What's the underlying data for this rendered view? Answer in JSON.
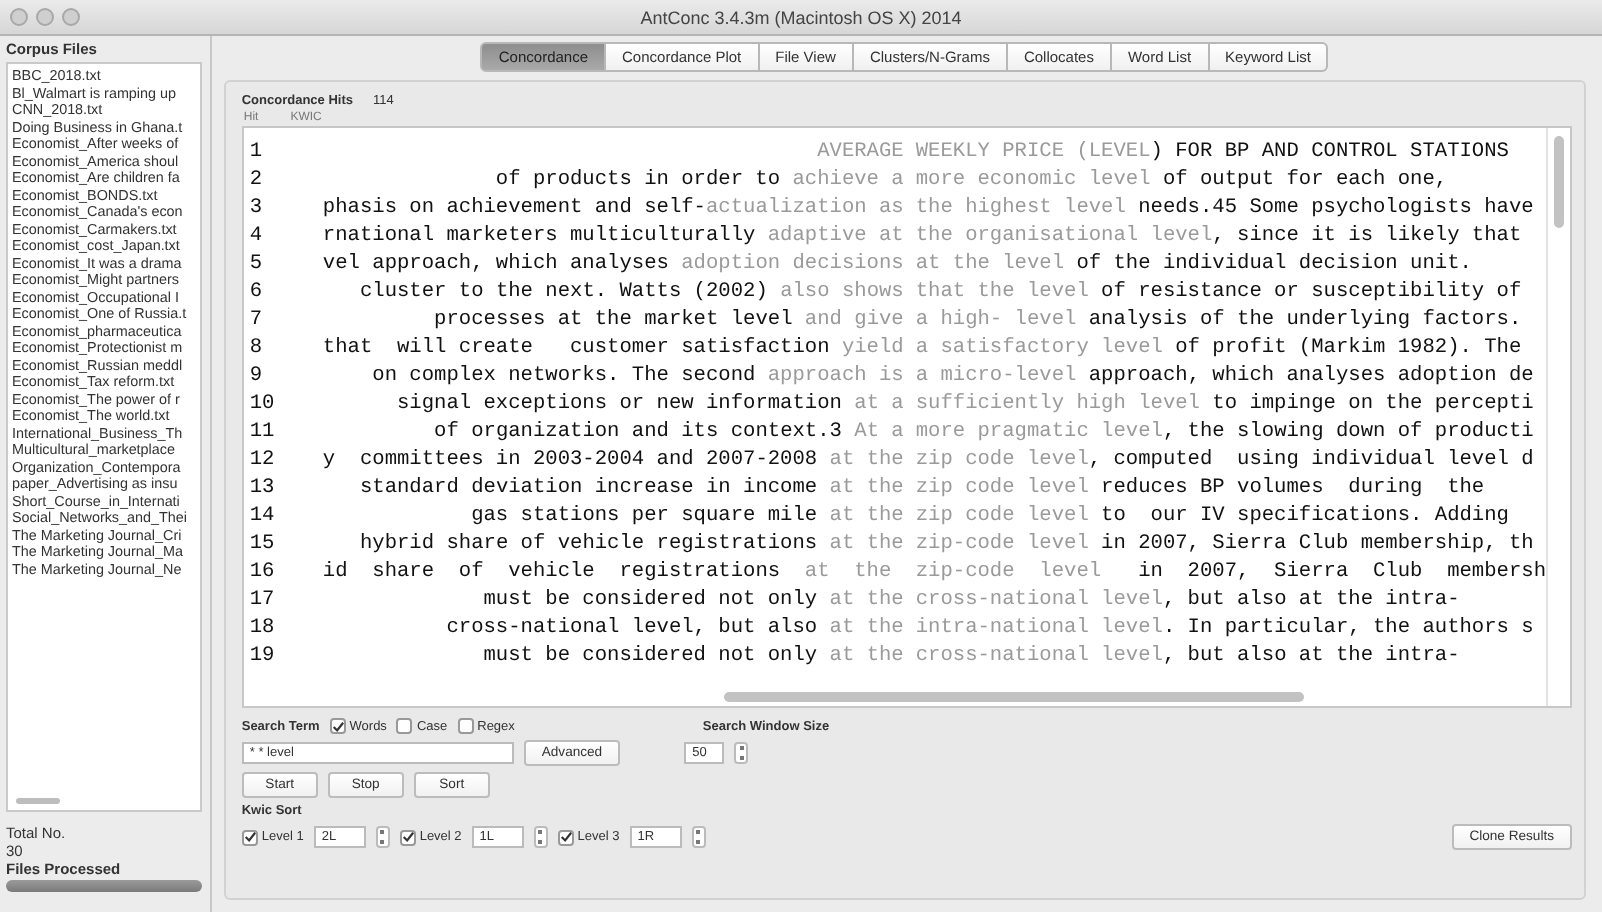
{
  "window": {
    "title": "AntConc 3.4.3m (Macintosh OS X) 2014"
  },
  "sidebar": {
    "title": "Corpus Files",
    "files": [
      "BBC_2018.txt",
      "Bl_Walmart is ramping up",
      "CNN_2018.txt",
      "Doing Business in Ghana.t",
      "Economist_After weeks of",
      "Economist_America shoul",
      "Economist_Are children fa",
      "Economist_BONDS.txt",
      "Economist_Canada's econ",
      "Economist_Carmakers.txt",
      "Economist_cost_Japan.txt",
      "Economist_It was a drama",
      "Economist_Might partners",
      "Economist_Occupational I",
      "Economist_One of Russia.t",
      "Economist_pharmaceutica",
      "Economist_Protectionist m",
      "Economist_Russian meddl",
      "Economist_Tax reform.txt",
      "Economist_The power of r",
      "Economist_The world.txt",
      "International_Business_Th",
      "Multicultural_marketplace",
      "Organization_Contempora",
      "paper_Advertising as insu",
      "Short_Course_in_Internati",
      "Social_Networks_and_Thei",
      "The Marketing Journal_Cri",
      "The Marketing Journal_Ma",
      "The Marketing Journal_Ne"
    ],
    "total_label": "Total No.",
    "total": "30",
    "processed_label": "Files Processed",
    "progress": {
      "level": 1
    }
  },
  "tabs": [
    {
      "label": "Concordance",
      "selected": true
    },
    {
      "label": "Concordance Plot",
      "selected": false
    },
    {
      "label": "File View",
      "selected": false
    },
    {
      "label": "Clusters/N-Grams",
      "selected": false
    },
    {
      "label": "Collocates",
      "selected": false
    },
    {
      "label": "Word List",
      "selected": false
    },
    {
      "label": "Keyword List",
      "selected": false
    }
  ],
  "hits": {
    "label": "Concordance Hits",
    "count": "114"
  },
  "columns": [
    "Hit",
    "KWIC"
  ],
  "rows": [
    {
      "n": "1",
      "left": "",
      "left_key": "AVERAGE",
      "right_key": "WEEKLY PRICE (LEVEL",
      "right": ") FOR BP AND CONTROL STATIONS"
    },
    {
      "n": "2",
      "left": "of products in order to",
      "left_key": "achieve a",
      "right_key": "more economic level",
      "right": "of output for each one,"
    },
    {
      "n": "3",
      "left": "phasis on achievement and self-",
      "left_key": "actualization as",
      "right_key": "the highest level",
      "right": "needs.45 Some psychologists have"
    },
    {
      "n": "4",
      "left": "rnational marketers multiculturally",
      "left_key": "adaptive at",
      "right_key": "the organisational level",
      "right": ", since it is likely that"
    },
    {
      "n": "5",
      "left": "vel approach, which analyses",
      "left_key": "adoption decisions",
      "right_key": "at the level",
      "right": "of the individual decision unit."
    },
    {
      "n": "6",
      "left": "cluster to the next. Watts (2002)",
      "left_key": "also shows",
      "right_key": "that the level",
      "right": "of resistance or susceptibility of"
    },
    {
      "n": "7",
      "left": "processes at the market level",
      "left_key": "and give",
      "right_key": "a high- level",
      "right": "analysis of the underlying factors."
    },
    {
      "n": "8",
      "left": "that  will create   customer satisfaction",
      "left_key": "yield",
      "right_key": "a satisfactory level",
      "right": "of profit (Markim 1982). The"
    },
    {
      "n": "9",
      "left": "on complex networks. The second",
      "left_key": "approach is",
      "right_key": "a micro-level",
      "right": "approach, which analyses adoption de"
    },
    {
      "n": "10",
      "left": "signal exceptions or new information",
      "left_key": "at a",
      "right_key": "sufficiently high level",
      "right": "to impinge on the percepti"
    },
    {
      "n": "11",
      "left": "of organization and its context.3",
      "left_key": "At a",
      "right_key": "more pragmatic level",
      "right": ", the slowing down of producti"
    },
    {
      "n": "12",
      "left": "y  committees in 2003-2004 and 2007-2008",
      "left_key": "at the",
      "right_key": "zip code level",
      "right": ", computed  using individual level d"
    },
    {
      "n": "13",
      "left": "standard deviation increase in income",
      "left_key": "at the",
      "right_key": "zip code level",
      "right": "reduces BP volumes  during  the"
    },
    {
      "n": "14",
      "left": "gas stations per square mile",
      "left_key": "at the",
      "right_key": "zip code level",
      "right": "to  our IV specifications. Adding"
    },
    {
      "n": "15",
      "left": "hybrid share of vehicle registrations",
      "left_key": "at the",
      "right_key": "zip-code level",
      "right": "in 2007, Sierra Club membership, th"
    },
    {
      "n": "16",
      "left": "id  share  of  vehicle  registrations",
      "left_key": " at  the ",
      "right_key": "zip-code  level",
      "right": "  in  2007,  Sierra  Club  membersh"
    },
    {
      "n": "17",
      "left": "must be considered not only",
      "left_key": "at the",
      "right_key": "cross-national level",
      "right": ", but also at the intra-"
    },
    {
      "n": "18",
      "left": "cross-national level, but also",
      "left_key": "at the",
      "right_key": "intra-national level",
      "right": ". In particular, the authors s"
    },
    {
      "n": "19",
      "left": "must be considered not only",
      "left_key": "at the",
      "right_key": "cross-national level",
      "right": ", but also at the intra-"
    }
  ],
  "search": {
    "label": "Search Term",
    "options": [
      {
        "label": "Words",
        "checked": true
      },
      {
        "label": "Case",
        "checked": false
      },
      {
        "label": "Regex",
        "checked": false
      }
    ],
    "value": "* * level",
    "advanced": "Advanced",
    "window_label": "Search Window Size",
    "window_size": "50"
  },
  "actions": [
    "Start",
    "Stop",
    "Sort"
  ],
  "kwic_sort": {
    "label": "Kwic Sort",
    "levels": [
      {
        "label": "Level 1",
        "checked": true,
        "value": "2L"
      },
      {
        "label": "Level 2",
        "checked": true,
        "value": "1L"
      },
      {
        "label": "Level 3",
        "checked": true,
        "value": "1R"
      }
    ]
  },
  "clone": "Clone Results"
}
